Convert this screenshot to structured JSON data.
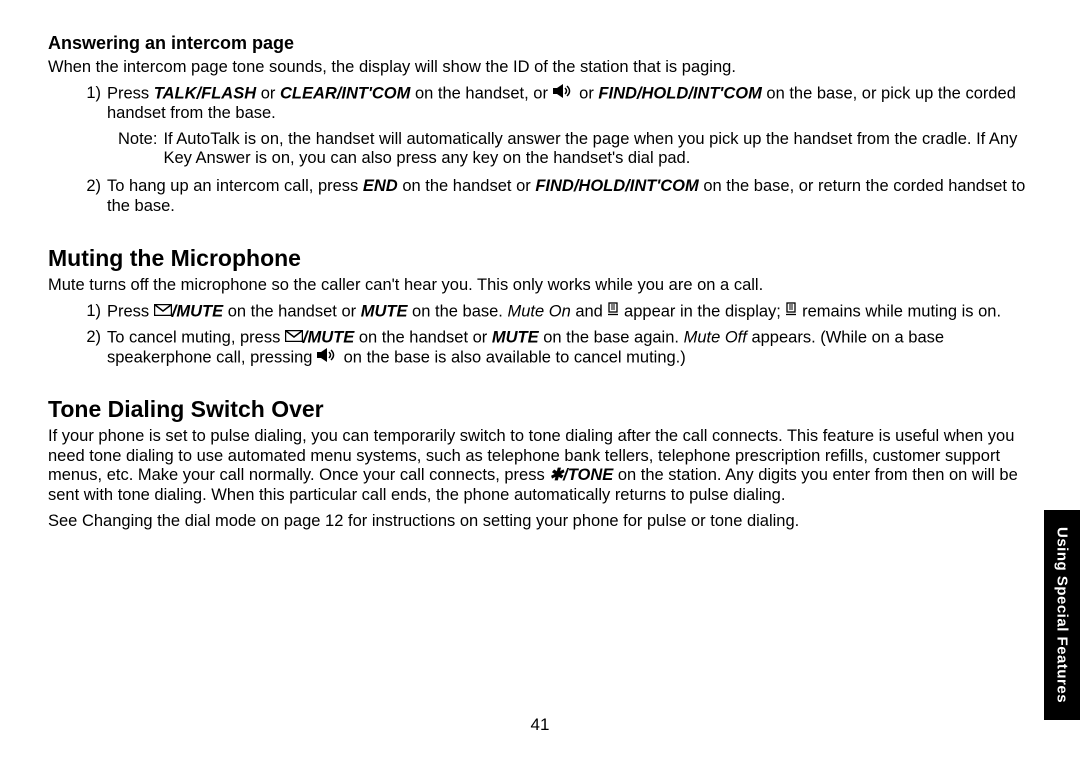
{
  "section1": {
    "heading": "Answering an intercom page",
    "intro": "When the intercom page tone sounds, the display will show the ID of the station that is paging.",
    "item1_pre": "Press ",
    "talk_flash": "TALK/FLASH",
    "or1": " or ",
    "clear_intcom": "CLEAR/INT'COM",
    "item1_mid": " on the handset, or ",
    "or2": " or ",
    "find_hold": "FIND/HOLD/INT'COM",
    "item1_post": " on the base, or pick up the corded handset from the base.",
    "note_label": "Note:",
    "note_text": "If AutoTalk is on, the handset will automatically answer the page when you pick up the handset from the cradle. If Any Key Answer is on, you can also press any key on the handset's dial pad.",
    "item2_pre": "To hang up an intercom call, press ",
    "end": "END",
    "item2_mid": " on the handset or ",
    "find_hold2": "FIND/HOLD/INT'COM",
    "item2_post": " on the base, or return the corded handset to the base."
  },
  "section2": {
    "heading": "Muting the Microphone",
    "intro": "Mute turns off the microphone so the caller can't hear you. This only works while you are on a call.",
    "item1_pre": "Press ",
    "mute1": "/MUTE",
    "item1_mid": " on the handset or ",
    "mute2": "MUTE",
    "item1_mid2": " on the base. ",
    "mute_on": "Mute On",
    "and": " and ",
    "item1_mid3": " appear in the display; ",
    "item1_post": " remains while muting is on.",
    "item2_pre": "To cancel muting, press ",
    "mute3": "/MUTE",
    "item2_mid": " on the handset or ",
    "mute4": "MUTE",
    "item2_mid2": " on the base again. ",
    "mute_off": "Mute Off",
    "item2_mid3": " appears. (While on a base speakerphone call, pressing ",
    "item2_post": " on the base is also available to cancel muting.)"
  },
  "section3": {
    "heading": "Tone Dialing Switch Over",
    "para_pre": "If your phone is set to pulse dialing, you can temporarily switch to tone dialing after the call connects. This feature is useful when you need tone dialing to use automated menu systems, such as telephone bank tellers, telephone prescription refills, customer support menus, etc. Make your call normally. Once your call connects, press ",
    "star_tone": "✱/TONE",
    "para_post": " on the station. Any digits you enter from then on will be sent with tone dialing. When this particular call ends, the phone automatically returns to pulse dialing.",
    "see": "See Changing the dial mode on page 12 for instructions on setting your phone for pulse or tone dialing."
  },
  "side_tab": "Using Special Features",
  "page_number": "41"
}
